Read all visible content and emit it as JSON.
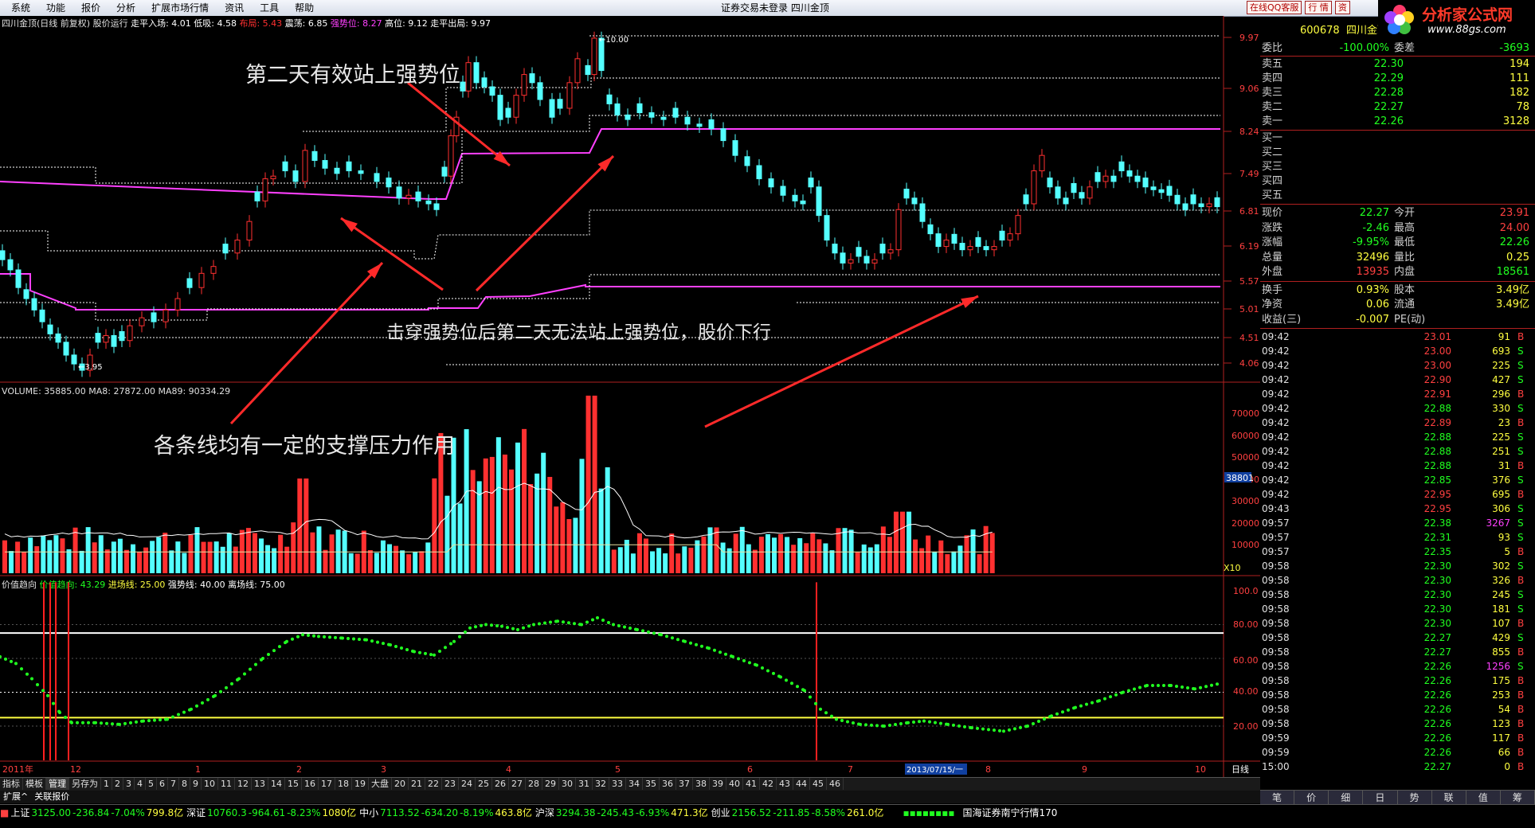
{
  "menu": [
    "系统",
    "功能",
    "报价",
    "分析",
    "扩展市场行情",
    "资讯",
    "工具",
    "帮助"
  ],
  "window_title": "证券交易未登录   四川金顶",
  "title_buttons": [
    "在线QQ客服",
    "行 情",
    "资"
  ],
  "logo": {
    "name": "分析家公式网",
    "url": "www.88gs.com"
  },
  "main_header": {
    "name": "四川金顶(日线 前复权) 股价运行",
    "items": [
      {
        "label": "走平入场: 4.01",
        "color": "#ffffff"
      },
      {
        "label": "低吸: 4.58",
        "color": "#ffffff"
      },
      {
        "label": "布局: 5.43",
        "color": "#ff3030"
      },
      {
        "label": "震荡: 6.85",
        "color": "#ffffff"
      },
      {
        "label": "强势位: 8.27",
        "color": "#ff40ff"
      },
      {
        "label": "高位: 9.12",
        "color": "#ffffff"
      },
      {
        "label": "走平出局: 9.97",
        "color": "#ffffff"
      }
    ]
  },
  "price_axis": [
    "9.97",
    "9.06",
    "8.24",
    "7.49",
    "6.81",
    "6.19",
    "5.57",
    "5.01",
    "4.51",
    "4.06"
  ],
  "price_marks": {
    "high": "10.00",
    "low": "3.95"
  },
  "volume_header": "VOLUME: 35885.00  MA8: 27872.00  MA89: 90334.29",
  "volume_axis": [
    "70000",
    "60000",
    "50000",
    "40000",
    "30000",
    "20000",
    "10000"
  ],
  "volume_tag": "38801",
  "volume_unit": "X10",
  "indicator_header": {
    "name": "价值趋向",
    "items": [
      {
        "label": "价值趋向: 43.29",
        "color": "#20ff20"
      },
      {
        "label": "进场线: 25.00",
        "color": "#ffff40"
      },
      {
        "label": "强势线: 40.00",
        "color": "#ffffff"
      },
      {
        "label": "离场线: 75.00",
        "color": "#ffffff"
      }
    ]
  },
  "indicator_axis": [
    "100.0",
    "80.00",
    "60.00",
    "40.00",
    "20.00"
  ],
  "date_axis": {
    "left": "2011年",
    "months": [
      "12",
      "1",
      "2",
      "3",
      "4",
      "5",
      "6",
      "7",
      "8",
      "9",
      "10"
    ],
    "cursor": "2013/07/15/一",
    "period": "日线"
  },
  "annotations": [
    "第二天有效站上强势位",
    "击穿强势位后第二天无法站上强势位，股价下行",
    "各条线均有一定的支撑压力作用"
  ],
  "quote": {
    "code": "600678",
    "name": "四川金顶",
    "weibi": {
      "label": "委比",
      "value": "-100.00%",
      "label2": "委差",
      "value2": "-3693"
    },
    "sell": [
      {
        "label": "卖五",
        "price": "22.30",
        "vol": "194"
      },
      {
        "label": "卖四",
        "price": "22.29",
        "vol": "111"
      },
      {
        "label": "卖三",
        "price": "22.28",
        "vol": "182"
      },
      {
        "label": "卖二",
        "price": "22.27",
        "vol": "78"
      },
      {
        "label": "卖一",
        "price": "22.26",
        "vol": "3128"
      }
    ],
    "buy": [
      {
        "label": "买一",
        "price": "",
        "vol": ""
      },
      {
        "label": "买二",
        "price": "",
        "vol": ""
      },
      {
        "label": "买三",
        "price": "",
        "vol": ""
      },
      {
        "label": "买四",
        "price": "",
        "vol": ""
      },
      {
        "label": "买五",
        "price": "",
        "vol": ""
      }
    ],
    "stats": [
      {
        "l1": "现价",
        "v1": "22.27",
        "c1": "#20ff20",
        "l2": "今开",
        "v2": "23.91",
        "c2": "#ff4040"
      },
      {
        "l1": "涨跌",
        "v1": "-2.46",
        "c1": "#20ff20",
        "l2": "最高",
        "v2": "24.00",
        "c2": "#ff4040"
      },
      {
        "l1": "涨幅",
        "v1": "-9.95%",
        "c1": "#20ff20",
        "l2": "最低",
        "v2": "22.26",
        "c2": "#20ff20"
      },
      {
        "l1": "总量",
        "v1": "32496",
        "c1": "#ffff40",
        "l2": "量比",
        "v2": "0.25",
        "c2": "#ffff40"
      },
      {
        "l1": "外盘",
        "v1": "13935",
        "c1": "#ff4040",
        "l2": "内盘",
        "v2": "18561",
        "c2": "#20ff20"
      },
      {
        "l1": "换手",
        "v1": "0.93%",
        "c1": "#ffff40",
        "l2": "股本",
        "v2": "3.49亿",
        "c2": "#ffff40"
      },
      {
        "l1": "净资",
        "v1": "0.06",
        "c1": "#ffff40",
        "l2": "流通",
        "v2": "3.49亿",
        "c2": "#ffff40"
      },
      {
        "l1": "收益(三)",
        "v1": "-0.007",
        "c1": "#ffff40",
        "l2": "PE(动)",
        "v2": "",
        "c2": "#ffff40"
      }
    ]
  },
  "ticks": [
    {
      "t": "09:42",
      "p": "23.01",
      "v": "91",
      "d": "B"
    },
    {
      "t": "09:42",
      "p": "23.00",
      "v": "693",
      "d": "S"
    },
    {
      "t": "09:42",
      "p": "23.00",
      "v": "225",
      "d": "S"
    },
    {
      "t": "09:42",
      "p": "22.90",
      "v": "427",
      "d": "S"
    },
    {
      "t": "09:42",
      "p": "22.91",
      "v": "296",
      "d": "B"
    },
    {
      "t": "09:42",
      "p": "22.88",
      "v": "330",
      "d": "S"
    },
    {
      "t": "09:42",
      "p": "22.89",
      "v": "23",
      "d": "B"
    },
    {
      "t": "09:42",
      "p": "22.88",
      "v": "225",
      "d": "S"
    },
    {
      "t": "09:42",
      "p": "22.88",
      "v": "251",
      "d": "S"
    },
    {
      "t": "09:42",
      "p": "22.88",
      "v": "31",
      "d": "B"
    },
    {
      "t": "09:42",
      "p": "22.85",
      "v": "376",
      "d": "S"
    },
    {
      "t": "09:42",
      "p": "22.95",
      "v": "695",
      "d": "B"
    },
    {
      "t": "09:43",
      "p": "22.95",
      "v": "306",
      "d": "S"
    },
    {
      "t": "09:57",
      "p": "22.38",
      "v": "3267",
      "d": "S"
    },
    {
      "t": "09:57",
      "p": "22.31",
      "v": "93",
      "d": "S"
    },
    {
      "t": "09:57",
      "p": "22.35",
      "v": "5",
      "d": "B"
    },
    {
      "t": "09:58",
      "p": "22.30",
      "v": "302",
      "d": "S"
    },
    {
      "t": "09:58",
      "p": "22.30",
      "v": "326",
      "d": "B"
    },
    {
      "t": "09:58",
      "p": "22.30",
      "v": "245",
      "d": "S"
    },
    {
      "t": "09:58",
      "p": "22.30",
      "v": "181",
      "d": "S"
    },
    {
      "t": "09:58",
      "p": "22.30",
      "v": "107",
      "d": "B"
    },
    {
      "t": "09:58",
      "p": "22.27",
      "v": "429",
      "d": "S"
    },
    {
      "t": "09:58",
      "p": "22.27",
      "v": "855",
      "d": "B"
    },
    {
      "t": "09:58",
      "p": "22.26",
      "v": "1256",
      "d": "S"
    },
    {
      "t": "09:58",
      "p": "22.26",
      "v": "175",
      "d": "B"
    },
    {
      "t": "09:58",
      "p": "22.26",
      "v": "253",
      "d": "B"
    },
    {
      "t": "09:58",
      "p": "22.26",
      "v": "54",
      "d": "B"
    },
    {
      "t": "09:58",
      "p": "22.26",
      "v": "123",
      "d": "B"
    },
    {
      "t": "09:59",
      "p": "22.26",
      "v": "117",
      "d": "B"
    },
    {
      "t": "09:59",
      "p": "22.26",
      "v": "66",
      "d": "B"
    },
    {
      "t": "15:00",
      "p": "22.27",
      "v": "0",
      "d": "B"
    }
  ],
  "bottom_tabs": [
    "指标",
    "模板",
    "管理",
    "另存为",
    "1",
    "2",
    "3",
    "4",
    "5",
    "6",
    "7",
    "8",
    "9",
    "10",
    "11",
    "12",
    "13",
    "14",
    "15",
    "16",
    "17",
    "18",
    "19",
    "大盘",
    "20",
    "21",
    "22",
    "23",
    "24",
    "25",
    "26",
    "27",
    "28",
    "29",
    "30",
    "31",
    "32",
    "33",
    "34",
    "35",
    "36",
    "37",
    "38",
    "39",
    "40",
    "41",
    "42",
    "43",
    "44",
    "45",
    "46"
  ],
  "bottom_tabs2": [
    "扩展^",
    "关联报价"
  ],
  "right_tabs": [
    "笔",
    "价",
    "细",
    "日",
    "势",
    "联",
    "值",
    "筹"
  ],
  "status": [
    {
      "name": "上证",
      "val": "3125.00",
      "chg": "-236.84",
      "pct": "-7.04%",
      "amt": "799.8亿"
    },
    {
      "name": "深证",
      "val": "10760.3",
      "chg": "-964.61",
      "pct": "-8.23%",
      "amt": "1080亿"
    },
    {
      "name": "中小",
      "val": "7113.52",
      "chg": "-634.20",
      "pct": "-8.19%",
      "amt": "463.8亿"
    },
    {
      "name": "沪深",
      "val": "3294.38",
      "chg": "-245.43",
      "pct": "-6.93%",
      "amt": "471.3亿"
    },
    {
      "name": "创业",
      "val": "2156.52",
      "chg": "-211.85",
      "pct": "-8.58%",
      "amt": "261.0亿"
    }
  ],
  "status_tail": "国海证券南宁行情170"
}
